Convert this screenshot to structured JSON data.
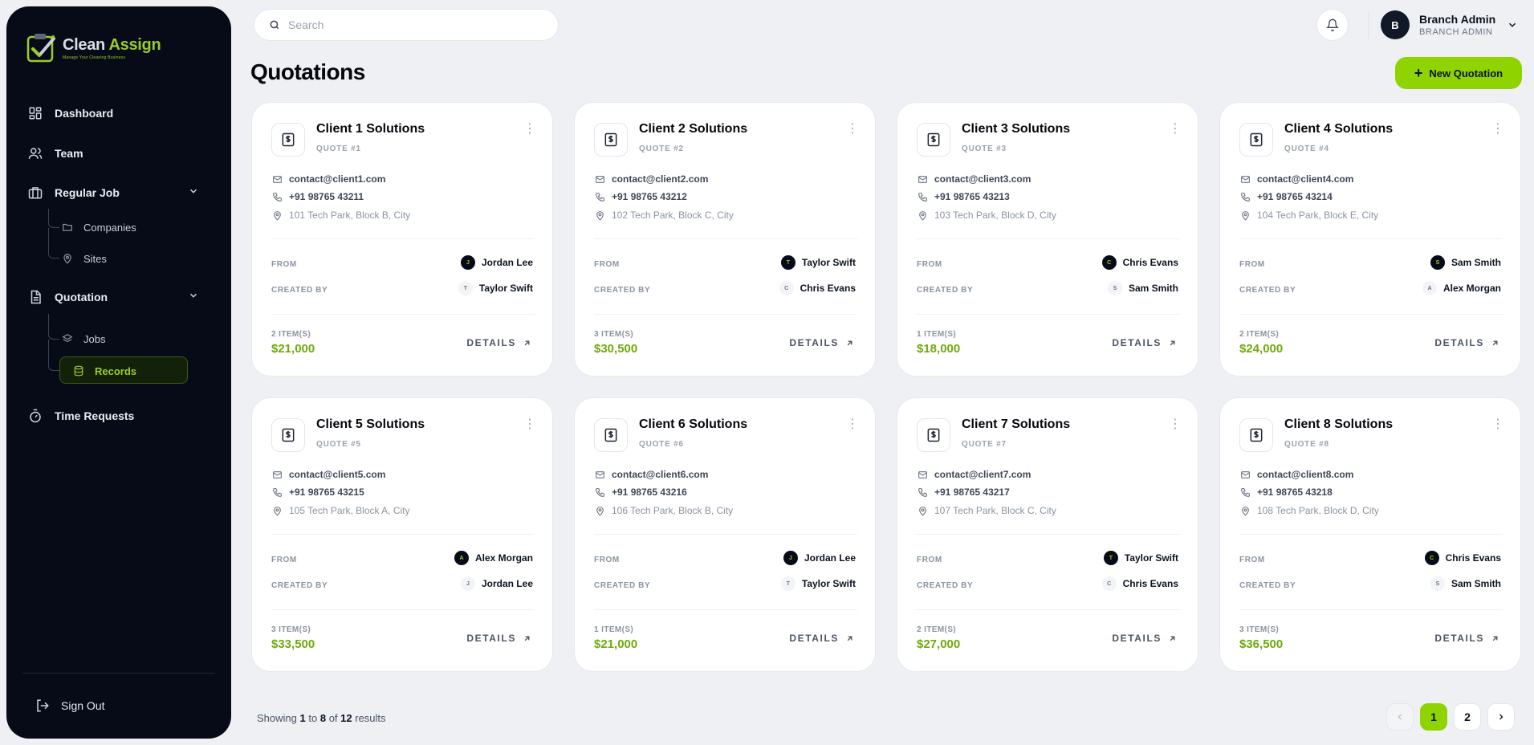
{
  "app": {
    "logo_name_part1": "Clean ",
    "logo_name_part2": "Assign",
    "logo_tagline": "Manage Your Cleaning Business"
  },
  "sidebar": {
    "items": [
      {
        "label": "Dashboard",
        "icon": "dashboard-icon"
      },
      {
        "label": "Team",
        "icon": "users-icon"
      },
      {
        "label": "Regular Job",
        "icon": "briefcase-icon"
      },
      {
        "label": "Quotation",
        "icon": "document-icon"
      },
      {
        "label": "Time Requests",
        "icon": "timer-icon"
      }
    ],
    "regular_job_sub": [
      {
        "label": "Companies",
        "icon": "folder-icon"
      },
      {
        "label": "Sites",
        "icon": "map-pin-icon"
      }
    ],
    "quotation_sub": [
      {
        "label": "Jobs",
        "icon": "layers-icon"
      },
      {
        "label": "Records",
        "icon": "database-icon"
      }
    ],
    "signout_label": "Sign Out"
  },
  "header": {
    "search_placeholder": "Search",
    "user_initial": "B",
    "user_name": "Branch Admin",
    "user_role": "BRANCH ADMIN"
  },
  "page": {
    "title": "Quotations",
    "new_button": "New Quotation",
    "from_label": "FROM",
    "created_by_label": "CREATED BY",
    "details_label": "DETAILS"
  },
  "quotes": [
    {
      "title": "Client 1 Solutions",
      "quote": "QUOTE #1",
      "email": "contact@client1.com",
      "phone": "+91 98765 43211",
      "address": "101 Tech Park, Block B, City",
      "from": "Jordan Lee",
      "from_initial": "J",
      "created_by": "Taylor Swift",
      "created_initial": "T",
      "items": "2 ITEM(S)",
      "price": "$21,000"
    },
    {
      "title": "Client 2 Solutions",
      "quote": "QUOTE #2",
      "email": "contact@client2.com",
      "phone": "+91 98765 43212",
      "address": "102 Tech Park, Block C, City",
      "from": "Taylor Swift",
      "from_initial": "T",
      "created_by": "Chris Evans",
      "created_initial": "C",
      "items": "3 ITEM(S)",
      "price": "$30,500"
    },
    {
      "title": "Client 3 Solutions",
      "quote": "QUOTE #3",
      "email": "contact@client3.com",
      "phone": "+91 98765 43213",
      "address": "103 Tech Park, Block D, City",
      "from": "Chris Evans",
      "from_initial": "C",
      "created_by": "Sam Smith",
      "created_initial": "S",
      "items": "1 ITEM(S)",
      "price": "$18,000"
    },
    {
      "title": "Client 4 Solutions",
      "quote": "QUOTE #4",
      "email": "contact@client4.com",
      "phone": "+91 98765 43214",
      "address": "104 Tech Park, Block E, City",
      "from": "Sam Smith",
      "from_initial": "S",
      "created_by": "Alex Morgan",
      "created_initial": "A",
      "items": "2 ITEM(S)",
      "price": "$24,000"
    },
    {
      "title": "Client 5 Solutions",
      "quote": "QUOTE #5",
      "email": "contact@client5.com",
      "phone": "+91 98765 43215",
      "address": "105 Tech Park, Block A, City",
      "from": "Alex Morgan",
      "from_initial": "A",
      "created_by": "Jordan Lee",
      "created_initial": "J",
      "items": "3 ITEM(S)",
      "price": "$33,500"
    },
    {
      "title": "Client 6 Solutions",
      "quote": "QUOTE #6",
      "email": "contact@client6.com",
      "phone": "+91 98765 43216",
      "address": "106 Tech Park, Block B, City",
      "from": "Jordan Lee",
      "from_initial": "J",
      "created_by": "Taylor Swift",
      "created_initial": "T",
      "items": "1 ITEM(S)",
      "price": "$21,000"
    },
    {
      "title": "Client 7 Solutions",
      "quote": "QUOTE #7",
      "email": "contact@client7.com",
      "phone": "+91 98765 43217",
      "address": "107 Tech Park, Block C, City",
      "from": "Taylor Swift",
      "from_initial": "T",
      "created_by": "Chris Evans",
      "created_initial": "C",
      "items": "2 ITEM(S)",
      "price": "$27,000"
    },
    {
      "title": "Client 8 Solutions",
      "quote": "QUOTE #8",
      "email": "contact@client8.com",
      "phone": "+91 98765 43218",
      "address": "108 Tech Park, Block D, City",
      "from": "Chris Evans",
      "from_initial": "C",
      "created_by": "Sam Smith",
      "created_initial": "S",
      "items": "3 ITEM(S)",
      "price": "$36,500"
    }
  ],
  "footer": {
    "showing_prefix": "Showing",
    "from": "1",
    "to_word": "to",
    "to": "8",
    "of_word": "of",
    "total": "12",
    "results_word": "results",
    "pages": [
      "1",
      "2"
    ],
    "current_page": "1"
  },
  "colors": {
    "accent": "#8fd400",
    "price": "#6eaa0a",
    "sidebar_bg": "#070b18"
  }
}
